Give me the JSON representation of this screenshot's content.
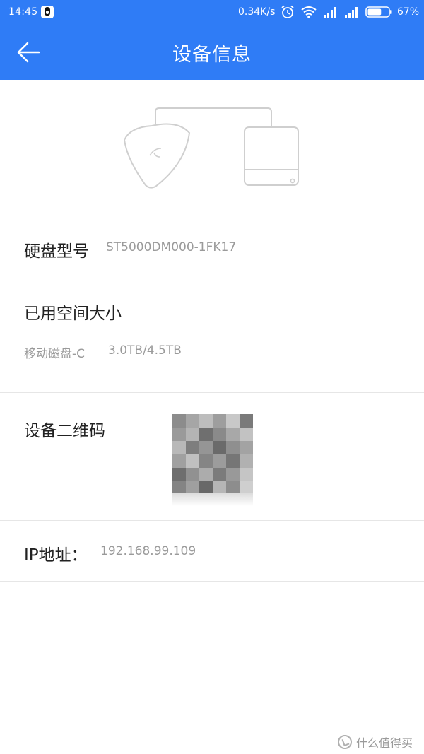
{
  "status_bar": {
    "time": "14:45",
    "net_speed": "0.34K/s",
    "battery_percent": "67%",
    "battery_level": 0.67,
    "icons": [
      "qq-icon",
      "alarm-icon",
      "wifi-icon",
      "signal-icon",
      "signal-icon",
      "battery-icon"
    ]
  },
  "header": {
    "title": "设备信息",
    "back_icon": "arrow-left-icon"
  },
  "hard_disk": {
    "label": "硬盘型号",
    "value": "ST5000DM000-1FK17"
  },
  "used_space": {
    "label": "已用空间大小",
    "disk_name": "移动磁盘-C",
    "usage": "3.0TB/4.5TB"
  },
  "qr_code": {
    "label": "设备二维码"
  },
  "ip": {
    "label": "IP地址：",
    "value": "192.168.99.109"
  },
  "watermark": {
    "text": "什么值得买"
  },
  "colors": {
    "header_blue": "#2F7CF6",
    "divider": "#E6E6E6",
    "label_text": "#222222",
    "value_text": "#9A9A9A"
  }
}
